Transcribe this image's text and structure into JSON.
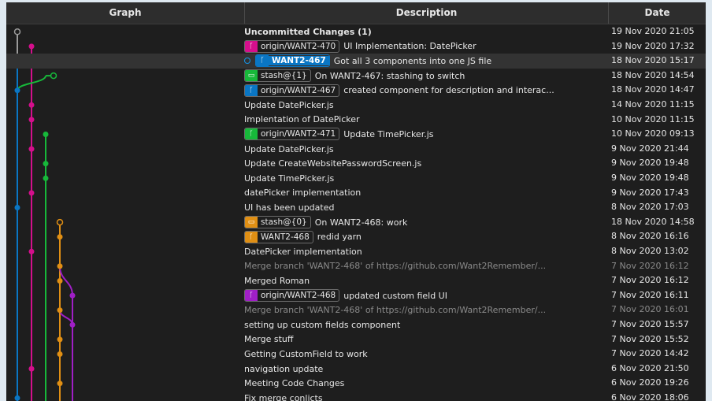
{
  "header": {
    "graph": "Graph",
    "description": "Description",
    "date": "Date"
  },
  "colors": {
    "gray": "#9a9a9a",
    "blue": "#0a76c4",
    "pink": "#d40f8c",
    "green": "#17b83a",
    "orange": "#e08f14",
    "purple": "#a01fc6"
  },
  "commits": [
    {
      "desc": "Uncommitted Changes (1)",
      "date": "19 Nov 2020 21:05",
      "bold": true
    },
    {
      "badge": {
        "text": "origin/WANT2-470",
        "color": "#d40f8c",
        "icon": "branch-icon"
      },
      "desc": "UI Implementation: DatePicker",
      "date": "19 Nov 2020 17:32"
    },
    {
      "head": true,
      "badge": {
        "text": "WANT2-467",
        "color": "#0a76c4",
        "icon": "branch-icon"
      },
      "desc": "Got all 3 components into one JS file",
      "date": "18 Nov 2020 15:17"
    },
    {
      "badge": {
        "text": "stash@{1}",
        "color": "#17b83a",
        "icon": "stash-icon"
      },
      "desc": "On WANT2-467: stashing to switch",
      "date": "18 Nov 2020 14:54"
    },
    {
      "badge": {
        "text": "origin/WANT2-467",
        "color": "#0a76c4",
        "icon": "branch-icon"
      },
      "desc": "created component for description and interac...",
      "date": "18 Nov 2020 14:47"
    },
    {
      "desc": "Update DatePicker.js",
      "date": "14 Nov 2020 11:15"
    },
    {
      "desc": "Implentation of DatePicker",
      "date": "10 Nov 2020 11:15"
    },
    {
      "badge": {
        "text": "origin/WANT2-471",
        "color": "#17b83a",
        "icon": "branch-icon"
      },
      "desc": "Update TimePicker.js",
      "date": "10 Nov 2020 09:13"
    },
    {
      "desc": "Update DatePicker.js",
      "date": "9 Nov 2020 21:44"
    },
    {
      "desc": "Update CreateWebsitePasswordScreen.js",
      "date": "9 Nov 2020 19:48"
    },
    {
      "desc": "Update TimePicker.js",
      "date": "9 Nov 2020 19:48"
    },
    {
      "desc": "datePicker implementation",
      "date": "9 Nov 2020 17:43"
    },
    {
      "desc": "UI has been updated",
      "date": "8 Nov 2020 17:03"
    },
    {
      "badge": {
        "text": "stash@{0}",
        "color": "#e08f14",
        "icon": "stash-icon"
      },
      "desc": "On WANT2-468: work",
      "date": "18 Nov 2020 14:58"
    },
    {
      "badge": {
        "text": "WANT2-468",
        "color": "#e08f14",
        "icon": "branch-icon"
      },
      "desc": "redid yarn",
      "date": "8 Nov 2020 16:16"
    },
    {
      "desc": "DatePicker implementation",
      "date": "8 Nov 2020 13:02"
    },
    {
      "desc": "Merge branch 'WANT2-468' of https://github.com/Want2Remember/...",
      "date": "7 Nov 2020 16:12",
      "dim": true
    },
    {
      "desc": "Merged Roman",
      "date": "7 Nov 2020 16:12"
    },
    {
      "badge": {
        "text": "origin/WANT2-468",
        "color": "#a01fc6",
        "icon": "branch-icon"
      },
      "desc": "updated custom field UI",
      "date": "7 Nov 2020 16:11"
    },
    {
      "desc": "Merge branch 'WANT2-468' of https://github.com/Want2Remember/...",
      "date": "7 Nov 2020 16:01",
      "dim": true
    },
    {
      "desc": "setting up custom fields component",
      "date": "7 Nov 2020 15:57"
    },
    {
      "desc": "Merge stuff",
      "date": "7 Nov 2020 15:52"
    },
    {
      "desc": "Getting CustomField to work",
      "date": "7 Nov 2020 14:42"
    },
    {
      "desc": "navigation update",
      "date": "6 Nov 2020 21:50"
    },
    {
      "desc": "Meeting Code Changes",
      "date": "6 Nov 2020 19:26"
    },
    {
      "desc": "Fix merge conlicts",
      "date": "6 Nov 2020 18:06"
    }
  ]
}
